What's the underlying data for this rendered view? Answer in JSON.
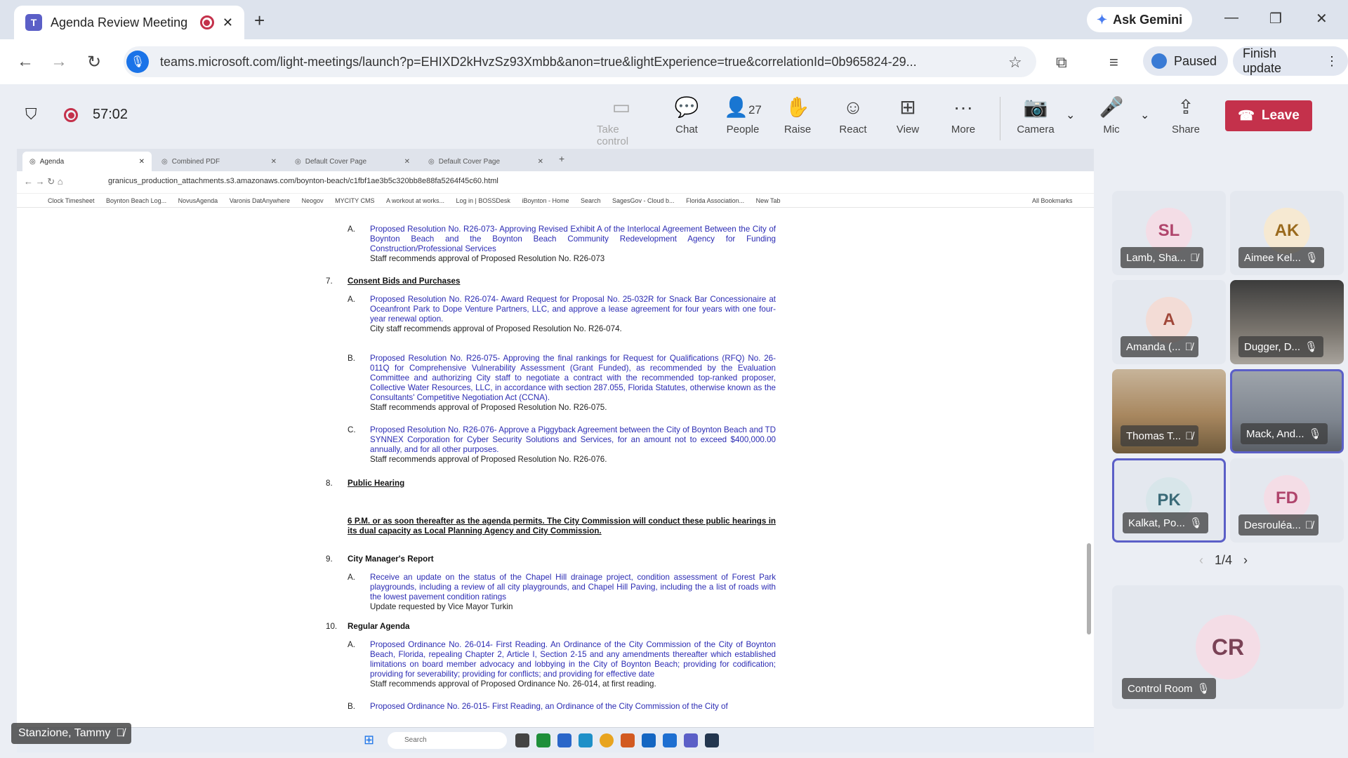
{
  "browser": {
    "tab_title": "Agenda Review Meeting | M",
    "ask_gemini": "Ask Gemini",
    "url": "teams.microsoft.com/light-meetings/launch?p=EHIXD2kHvzSz93Xmbb&anon=true&lightExperience=true&correlationId=0b965824-29...",
    "paused_label": "Paused",
    "finish_update_label": "Finish update"
  },
  "meeting": {
    "timer": "57:02",
    "toolbar": {
      "take_control": "Take control",
      "chat": "Chat",
      "people": "People",
      "people_count": "27",
      "raise": "Raise",
      "react": "React",
      "view": "View",
      "more": "More",
      "camera": "Camera",
      "mic": "Mic",
      "share": "Share",
      "leave": "Leave"
    },
    "pager": "1/4",
    "self_name": "Stanzione, Tammy",
    "colors": {
      "leave": "#c4314b",
      "accent": "#5b5fc7"
    }
  },
  "shared": {
    "tabs": [
      "Agenda",
      "Combined PDF",
      "Default Cover Page",
      "Default Cover Page"
    ],
    "url": "granicus_production_attachments.s3.amazonaws.com/boynton-beach/c1fbf1ae3b5c320bb8e88fa5264f45c60.html",
    "bookmarks": [
      "Clock Timesheet",
      "Boynton Beach Log...",
      "NovusAgenda",
      "Varonis DatAnywhere",
      "Neogov",
      "MYCITY CMS",
      "A workout at works...",
      "Log in | BOSSDesk",
      "iBoynton - Home",
      "Search",
      "SagesGov - Cloud b...",
      "Florida Association...",
      "New Tab",
      "All Bookmarks"
    ],
    "taskbar_search": "Search",
    "agenda": {
      "item6A": {
        "letter": "A.",
        "text": "Proposed Resolution No. R26-073- Approving Revised Exhibit A of the Interlocal Agreement Between the City of Boynton Beach and the Boynton Beach Community Redevelopment Agency for Funding Construction/Professional Services",
        "staff": "Staff recommends approval of Proposed Resolution No. R26-073"
      },
      "s7": {
        "num": "7.",
        "title": "Consent Bids and Purchases"
      },
      "item7A": {
        "letter": "A.",
        "text": "Proposed Resolution No. R26-074- Award Request for Proposal No. 25-032R for Snack Bar Concessionaire at Oceanfront Park to Dope Venture Partners, LLC, and approve a lease agreement for four years with one four-year renewal option.",
        "staff": "City staff recommends approval of Proposed Resolution No. R26-074."
      },
      "item7B": {
        "letter": "B.",
        "text": "Proposed Resolution No. R26-075- Approving the final rankings for Request for Qualifications (RFQ) No. 26-011Q for Comprehensive Vulnerability Assessment (Grant Funded), as recommended by the Evaluation Committee and authorizing City staff to negotiate a contract with the recommended top-ranked proposer, Collective Water Resources, LLC, in accordance with section 287.055, Florida Statutes, otherwise known as the Consultants' Competitive Negotiation Act (CCNA).",
        "staff": "Staff recommends approval of Proposed Resolution No. R26-075."
      },
      "item7C": {
        "letter": "C.",
        "text": "Proposed Resolution No. R26-076- Approve a Piggyback Agreement between the City of Boynton Beach and TD SYNNEX Corporation for Cyber Security Solutions and Services, for an amount not to exceed $400,000.00 annually, and for all other purposes.",
        "staff": "Staff recommends approval of Proposed Resolution No. R26-076."
      },
      "s8": {
        "num": "8.",
        "title": "Public Hearing"
      },
      "notice": "6 P.M. or as soon thereafter as the agenda permits. The City Commission will conduct these public hearings in its dual capacity as Local Planning Agency and City Commission.",
      "s9": {
        "num": "9.",
        "title": "City Manager's Report"
      },
      "item9A": {
        "letter": "A.",
        "text": "Receive an update on the status of the Chapel Hill drainage project, condition assessment of Forest Park playgrounds, including a review of all city playgrounds, and Chapel Hill Paving, including the a list of roads with the lowest pavement condition ratings",
        "staff": "Update requested by Vice Mayor Turkin"
      },
      "s10": {
        "num": "10.",
        "title": "Regular Agenda"
      },
      "item10A": {
        "letter": "A.",
        "text": "Proposed Ordinance No. 26-014- First Reading. An Ordinance of the City Commission of the City of Boynton Beach, Florida, repealing Chapter 2, Article I, Section 2-15 and any amendments thereafter which established limitations on board member advocacy and lobbying in the City of Boynton Beach; providing for codification; providing for severability; providing for conflicts; and providing for effective date",
        "staff": "Staff recommends approval of Proposed Ordinance No. 26-014, at first reading."
      },
      "item10B": {
        "letter": "B.",
        "text": "Proposed Ordinance No. 26-015- First Reading, an Ordinance of the City Commission of the City of"
      }
    }
  },
  "participants": [
    {
      "initials": "SL",
      "name": "Lamb, Sha...",
      "bg": "#f4dde6",
      "fg": "#b0456c"
    },
    {
      "initials": "AK",
      "name": "Aimee Kel...",
      "bg": "#f6e9d2",
      "fg": "#9a6a1d"
    },
    {
      "initials": "A",
      "name": "Amanda (...",
      "bg": "#f3dcd6",
      "fg": "#a1483a"
    },
    {
      "initials": "",
      "name": "Dugger, D...",
      "bg": "#6b6b6b",
      "fg": "#fff"
    },
    {
      "initials": "",
      "name": "Thomas T...",
      "bg": "#a88a6a",
      "fg": "#fff"
    },
    {
      "initials": "",
      "name": "Mack, And...",
      "bg": "#8a8f96",
      "fg": "#fff"
    },
    {
      "initials": "PK",
      "name": "Kalkat, Po...",
      "bg": "#d8e6ea",
      "fg": "#3b6b78"
    },
    {
      "initials": "FD",
      "name": "Desrouléa...",
      "bg": "#f4dde6",
      "fg": "#b0456c"
    }
  ],
  "control_room": {
    "initials": "CR",
    "name": "Control Room"
  }
}
